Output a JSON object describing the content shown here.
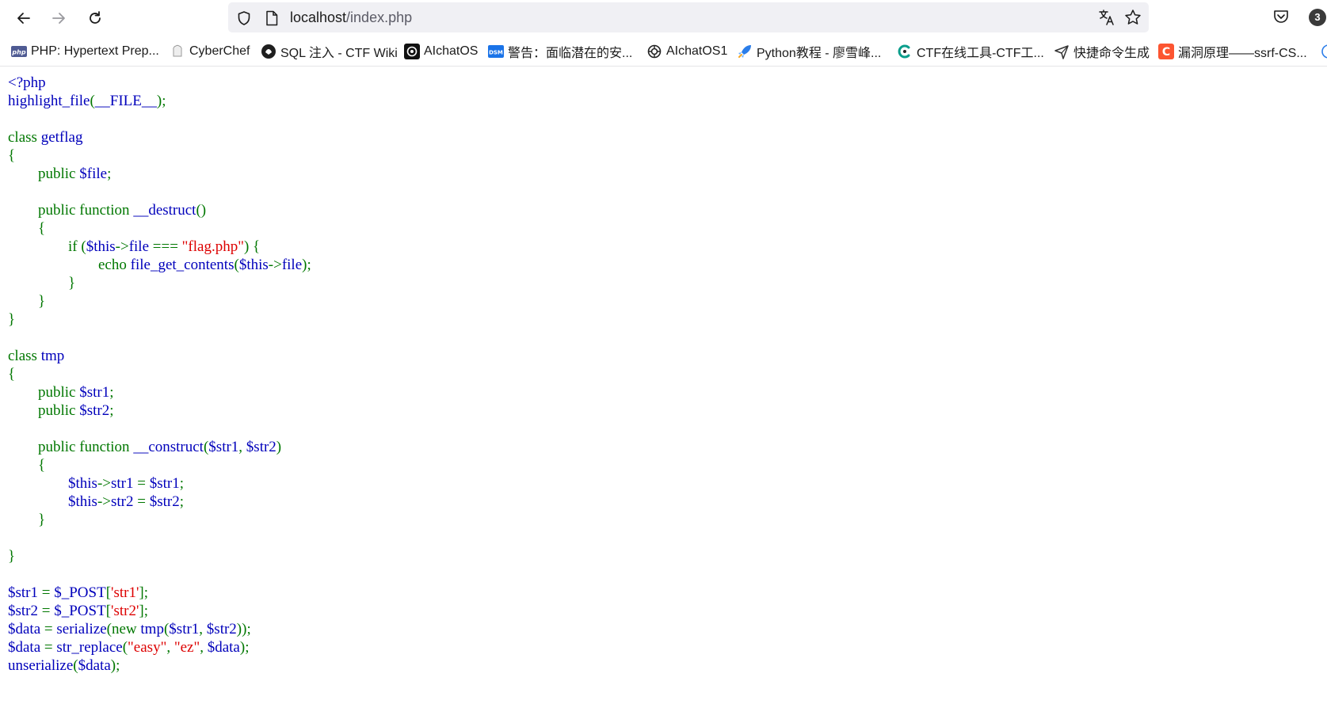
{
  "browser": {
    "back_label": "Back",
    "forward_label": "Forward",
    "reload_label": "Reload",
    "url": {
      "host": "localhost",
      "path": "/index.php"
    },
    "notification_count": "3"
  },
  "bookmarks": [
    {
      "label": "PHP: Hypertext Prep...",
      "icon": "php-icon"
    },
    {
      "label": "CyberChef",
      "icon": "cyberchef-icon"
    },
    {
      "label": "SQL 注入 - CTF Wiki",
      "icon": "ctf-wiki-icon"
    },
    {
      "label": "AIchatOS",
      "icon": "openai-icon"
    },
    {
      "label": "警告：面临潜在的安...",
      "icon": "dsm-icon"
    },
    {
      "label": "AIchatOS1",
      "icon": "openai-icon"
    },
    {
      "label": "Python教程 - 廖雪峰...",
      "icon": "rocket-icon"
    },
    {
      "label": "CTF在线工具-CTF工...",
      "icon": "ctf-tool-icon"
    },
    {
      "label": "快捷命令生成",
      "icon": "plane-icon"
    },
    {
      "label": "漏洞原理——ssrf-CS...",
      "icon": "csdn-icon"
    }
  ],
  "code_lines": [
    [
      {
        "t": "d",
        "v": "<?php"
      }
    ],
    [
      {
        "t": "d",
        "v": "highlight_file"
      },
      {
        "t": "k",
        "v": "("
      },
      {
        "t": "d",
        "v": "__FILE__"
      },
      {
        "t": "k",
        "v": ");"
      }
    ],
    [],
    [
      {
        "t": "k",
        "v": "class "
      },
      {
        "t": "d",
        "v": "getflag"
      }
    ],
    [
      {
        "t": "k",
        "v": "{"
      }
    ],
    [
      {
        "t": "k",
        "v": "        public "
      },
      {
        "t": "d",
        "v": "$file"
      },
      {
        "t": "k",
        "v": ";"
      }
    ],
    [],
    [
      {
        "t": "k",
        "v": "        public function "
      },
      {
        "t": "d",
        "v": "__destruct"
      },
      {
        "t": "k",
        "v": "()"
      }
    ],
    [
      {
        "t": "k",
        "v": "        {"
      }
    ],
    [
      {
        "t": "k",
        "v": "                if ("
      },
      {
        "t": "d",
        "v": "$this"
      },
      {
        "t": "k",
        "v": "->"
      },
      {
        "t": "d",
        "v": "file "
      },
      {
        "t": "k",
        "v": "=== "
      },
      {
        "t": "s",
        "v": "\"flag.php\""
      },
      {
        "t": "k",
        "v": ") {"
      }
    ],
    [
      {
        "t": "k",
        "v": "                        echo "
      },
      {
        "t": "d",
        "v": "file_get_contents"
      },
      {
        "t": "k",
        "v": "("
      },
      {
        "t": "d",
        "v": "$this"
      },
      {
        "t": "k",
        "v": "->"
      },
      {
        "t": "d",
        "v": "file"
      },
      {
        "t": "k",
        "v": ");"
      }
    ],
    [
      {
        "t": "k",
        "v": "                }"
      }
    ],
    [
      {
        "t": "k",
        "v": "        }"
      }
    ],
    [
      {
        "t": "k",
        "v": "}"
      }
    ],
    [],
    [
      {
        "t": "k",
        "v": "class "
      },
      {
        "t": "d",
        "v": "tmp"
      }
    ],
    [
      {
        "t": "k",
        "v": "{"
      }
    ],
    [
      {
        "t": "k",
        "v": "        public "
      },
      {
        "t": "d",
        "v": "$str1"
      },
      {
        "t": "k",
        "v": ";"
      }
    ],
    [
      {
        "t": "k",
        "v": "        public "
      },
      {
        "t": "d",
        "v": "$str2"
      },
      {
        "t": "k",
        "v": ";"
      }
    ],
    [],
    [
      {
        "t": "k",
        "v": "        public function "
      },
      {
        "t": "d",
        "v": "__construct"
      },
      {
        "t": "k",
        "v": "("
      },
      {
        "t": "d",
        "v": "$str1"
      },
      {
        "t": "k",
        "v": ", "
      },
      {
        "t": "d",
        "v": "$str2"
      },
      {
        "t": "k",
        "v": ")"
      }
    ],
    [
      {
        "t": "k",
        "v": "        {"
      }
    ],
    [
      {
        "t": "k",
        "v": "                "
      },
      {
        "t": "d",
        "v": "$this"
      },
      {
        "t": "k",
        "v": "->"
      },
      {
        "t": "d",
        "v": "str1 "
      },
      {
        "t": "k",
        "v": "= "
      },
      {
        "t": "d",
        "v": "$str1"
      },
      {
        "t": "k",
        "v": ";"
      }
    ],
    [
      {
        "t": "k",
        "v": "                "
      },
      {
        "t": "d",
        "v": "$this"
      },
      {
        "t": "k",
        "v": "->"
      },
      {
        "t": "d",
        "v": "str2 "
      },
      {
        "t": "k",
        "v": "= "
      },
      {
        "t": "d",
        "v": "$str2"
      },
      {
        "t": "k",
        "v": ";"
      }
    ],
    [
      {
        "t": "k",
        "v": "        }"
      }
    ],
    [],
    [
      {
        "t": "k",
        "v": "}"
      }
    ],
    [],
    [
      {
        "t": "d",
        "v": "$str1 "
      },
      {
        "t": "k",
        "v": "= "
      },
      {
        "t": "d",
        "v": "$_POST"
      },
      {
        "t": "k",
        "v": "["
      },
      {
        "t": "s",
        "v": "'str1'"
      },
      {
        "t": "k",
        "v": "];"
      }
    ],
    [
      {
        "t": "d",
        "v": "$str2 "
      },
      {
        "t": "k",
        "v": "= "
      },
      {
        "t": "d",
        "v": "$_POST"
      },
      {
        "t": "k",
        "v": "["
      },
      {
        "t": "s",
        "v": "'str2'"
      },
      {
        "t": "k",
        "v": "];"
      }
    ],
    [
      {
        "t": "d",
        "v": "$data "
      },
      {
        "t": "k",
        "v": "= "
      },
      {
        "t": "d",
        "v": "serialize"
      },
      {
        "t": "k",
        "v": "(new "
      },
      {
        "t": "d",
        "v": "tmp"
      },
      {
        "t": "k",
        "v": "("
      },
      {
        "t": "d",
        "v": "$str1"
      },
      {
        "t": "k",
        "v": ", "
      },
      {
        "t": "d",
        "v": "$str2"
      },
      {
        "t": "k",
        "v": "));"
      }
    ],
    [
      {
        "t": "d",
        "v": "$data "
      },
      {
        "t": "k",
        "v": "= "
      },
      {
        "t": "d",
        "v": "str_replace"
      },
      {
        "t": "k",
        "v": "("
      },
      {
        "t": "s",
        "v": "\"easy\""
      },
      {
        "t": "k",
        "v": ", "
      },
      {
        "t": "s",
        "v": "\"ez\""
      },
      {
        "t": "k",
        "v": ", "
      },
      {
        "t": "d",
        "v": "$data"
      },
      {
        "t": "k",
        "v": ");"
      }
    ],
    [
      {
        "t": "d",
        "v": "unserialize"
      },
      {
        "t": "k",
        "v": "("
      },
      {
        "t": "d",
        "v": "$data"
      },
      {
        "t": "k",
        "v": ");"
      }
    ]
  ],
  "colors": {
    "keyword": "#007700",
    "default": "#0000bb",
    "string": "#dd0000"
  }
}
